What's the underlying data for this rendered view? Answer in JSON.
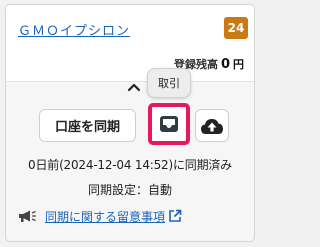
{
  "account": {
    "name": "ＧＭＯイプシロン",
    "badge_count": "24",
    "balance_label": "登録残高",
    "balance_value": "0",
    "balance_unit": "円"
  },
  "tooltip": {
    "text": "取引"
  },
  "actions": {
    "sync_label": "口座を同期",
    "transactions_icon": "inbox-tray-icon",
    "upload_icon": "cloud-upload-icon"
  },
  "status": {
    "sync_status": "0日前(2024-12-04 14:52)に同期済み",
    "sync_setting": "同期設定：自動"
  },
  "notice": {
    "link_text": "同期に関する留意事項",
    "icon": "megaphone-icon",
    "external_icon": "external-link-icon"
  },
  "colors": {
    "link": "#1a64b8",
    "badge": "#c97a12",
    "highlight": "#e8195a",
    "icon_dark": "#333333"
  }
}
